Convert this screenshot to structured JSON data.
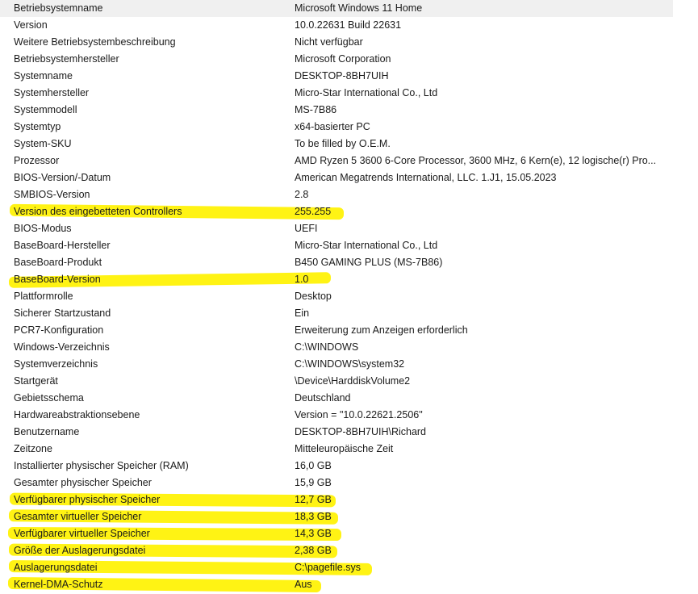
{
  "rows": [
    {
      "item": "Betriebsystemname",
      "value": "Microsoft Windows 11 Home"
    },
    {
      "item": "Version",
      "value": "10.0.22631 Build 22631"
    },
    {
      "item": "Weitere Betriebsystembeschreibung",
      "value": "Nicht verfügbar"
    },
    {
      "item": "Betriebsystemhersteller",
      "value": "Microsoft Corporation"
    },
    {
      "item": "Systemname",
      "value": "DESKTOP-8BH7UIH"
    },
    {
      "item": "Systemhersteller",
      "value": "Micro-Star International Co., Ltd"
    },
    {
      "item": "Systemmodell",
      "value": "MS-7B86"
    },
    {
      "item": "Systemtyp",
      "value": "x64-basierter PC"
    },
    {
      "item": "System-SKU",
      "value": "To be filled by O.E.M."
    },
    {
      "item": "Prozessor",
      "value": "AMD Ryzen 5 3600 6-Core Processor, 3600 MHz, 6 Kern(e), 12 logische(r) Pro..."
    },
    {
      "item": "BIOS-Version/-Datum",
      "value": "American Megatrends International, LLC. 1.J1, 15.05.2023"
    },
    {
      "item": "SMBIOS-Version",
      "value": "2.8"
    },
    {
      "item": "Version des eingebetteten Controllers",
      "value": "255.255"
    },
    {
      "item": "BIOS-Modus",
      "value": "UEFI"
    },
    {
      "item": "BaseBoard-Hersteller",
      "value": "Micro-Star International Co., Ltd"
    },
    {
      "item": "BaseBoard-Produkt",
      "value": "B450 GAMING PLUS (MS-7B86)"
    },
    {
      "item": "BaseBoard-Version",
      "value": "1.0"
    },
    {
      "item": "Plattformrolle",
      "value": "Desktop"
    },
    {
      "item": "Sicherer Startzustand",
      "value": "Ein"
    },
    {
      "item": "PCR7-Konfiguration",
      "value": "Erweiterung zum Anzeigen erforderlich"
    },
    {
      "item": "Windows-Verzeichnis",
      "value": "C:\\WINDOWS"
    },
    {
      "item": "Systemverzeichnis",
      "value": "C:\\WINDOWS\\system32"
    },
    {
      "item": "Startgerät",
      "value": "\\Device\\HarddiskVolume2"
    },
    {
      "item": "Gebietsschema",
      "value": "Deutschland"
    },
    {
      "item": "Hardwareabstraktionsebene",
      "value": "Version = \"10.0.22621.2506\""
    },
    {
      "item": "Benutzername",
      "value": "DESKTOP-8BH7UIH\\Richard"
    },
    {
      "item": "Zeitzone",
      "value": "Mitteleuropäische Zeit"
    },
    {
      "item": "Installierter physischer Speicher (RAM)",
      "value": "16,0 GB"
    },
    {
      "item": "Gesamter physischer Speicher",
      "value": "15,9 GB"
    },
    {
      "item": "Verfügbarer physischer Speicher",
      "value": "12,7 GB"
    },
    {
      "item": "Gesamter virtueller Speicher",
      "value": "18,3 GB"
    },
    {
      "item": "Verfügbarer virtueller Speicher",
      "value": "14,3 GB"
    },
    {
      "item": "Größe der Auslagerungsdatei",
      "value": "2,38 GB"
    },
    {
      "item": "Auslagerungsdatei",
      "value": "C:\\pagefile.sys"
    },
    {
      "item": "Kernel-DMA-Schutz",
      "value": "Aus"
    }
  ],
  "highlight_color": "#fff200"
}
